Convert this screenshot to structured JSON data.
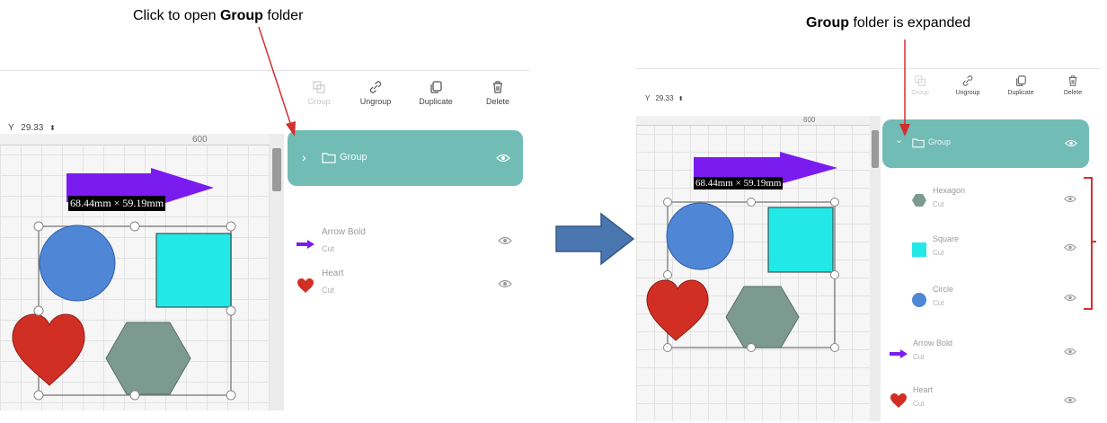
{
  "captions": {
    "left": {
      "pre": "Click to open ",
      "bold": "Group",
      "post": " folder"
    },
    "right": {
      "bold": "Group",
      "post": " folder is expanded"
    }
  },
  "left_panel": {
    "y_label": "Y",
    "y_value": "29.33",
    "ruler_mark": "600",
    "dimension": "68.44mm × 59.19mm",
    "toolbar": {
      "group": "Group",
      "ungroup": "Ungroup",
      "duplicate": "Duplicate",
      "delete": "Delete"
    },
    "layers": [
      {
        "name": "Group"
      },
      {
        "name": "Arrow Bold",
        "sub": "Cut"
      },
      {
        "name": "Heart",
        "sub": "Cut"
      }
    ]
  },
  "right_panel": {
    "y_label": "Y",
    "y_value": "29.33",
    "ruler_mark": "600",
    "dimension": "68.44mm × 59.19mm",
    "toolbar": {
      "group": "Group",
      "ungroup": "Ungroup",
      "duplicate": "Duplicate",
      "delete": "Delete"
    },
    "layers": [
      {
        "name": "Group"
      },
      {
        "name": "Hexagon",
        "sub": "Cut"
      },
      {
        "name": "Square",
        "sub": "Cut"
      },
      {
        "name": "Circle",
        "sub": "Cut"
      },
      {
        "name": "Arrow Bold",
        "sub": "Cut"
      },
      {
        "name": "Heart",
        "sub": "Cut"
      }
    ]
  },
  "colors": {
    "group_row": "#72bcb6",
    "circle": "#4f86d6",
    "square": "#22e8e8",
    "hexagon": "#7c9a90",
    "heart": "#d22f24",
    "arrow": "#7a1cf0",
    "annotation": "#d32f2f",
    "big_arrow": "#4a76b0"
  }
}
